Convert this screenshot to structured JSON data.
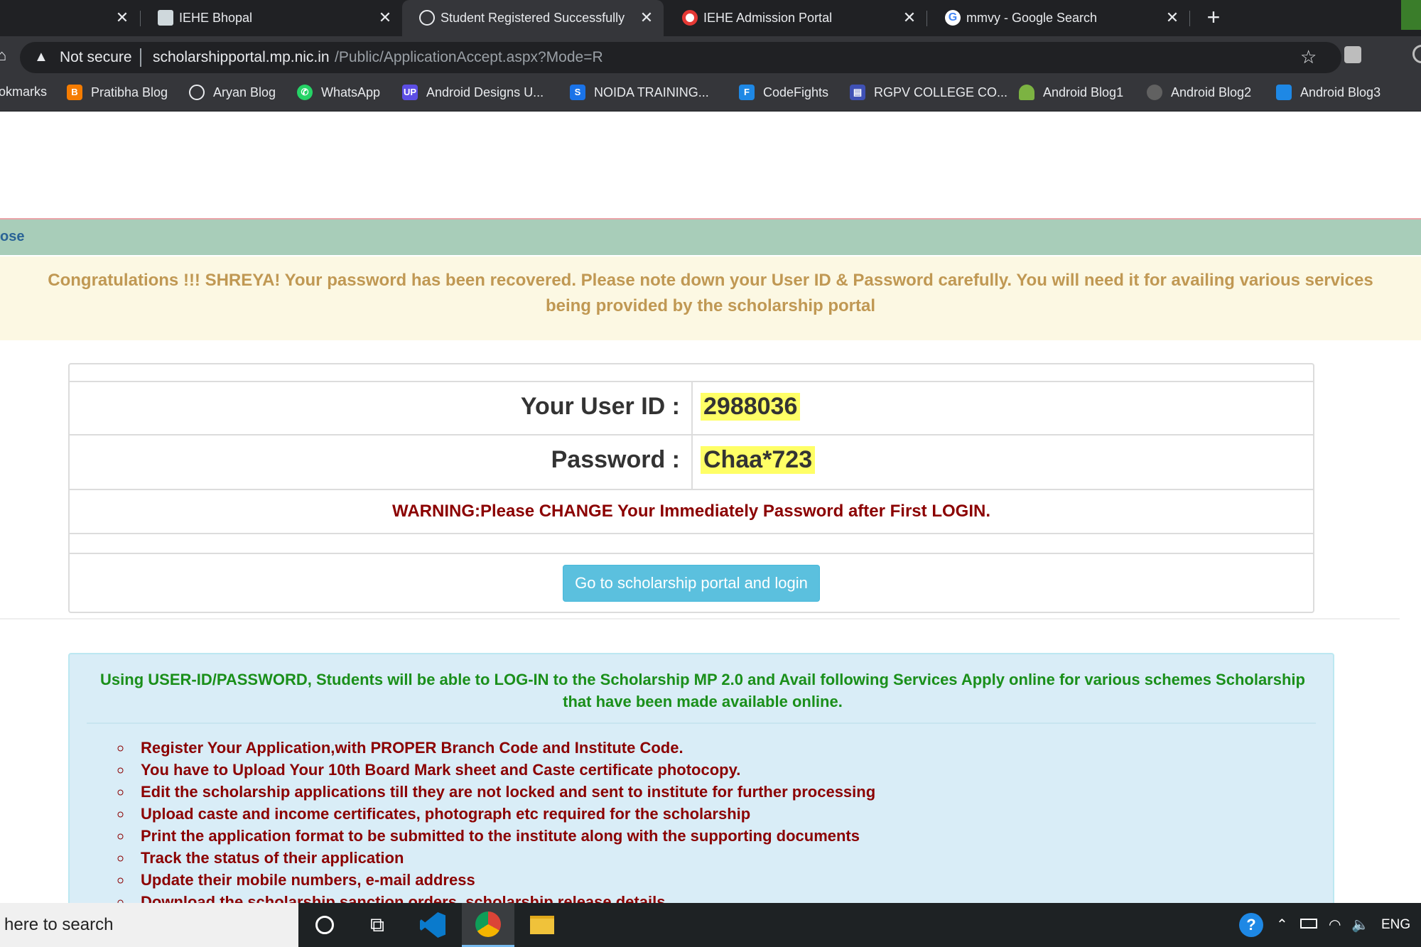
{
  "tabs": [
    {
      "title": "IEHE Bhopal",
      "active": false
    },
    {
      "title": "Student Registered Successfully",
      "active": true
    },
    {
      "title": "IEHE Admission Portal",
      "active": false
    },
    {
      "title": "mmvy - Google Search",
      "active": false
    }
  ],
  "new_tab_symbol": "+",
  "address": {
    "security": "Not secure",
    "host": "scholarshipportal.mp.nic.in",
    "path": "/Public/ApplicationAccept.aspx?Mode=R"
  },
  "bookmarks": [
    {
      "label": "okmarks",
      "icon": "folder-icon"
    },
    {
      "label": "Pratibha Blog",
      "icon": "blogger-icon",
      "color": "#f57c00"
    },
    {
      "label": "Aryan Blog",
      "icon": "globe-icon"
    },
    {
      "label": "WhatsApp",
      "icon": "whatsapp-icon",
      "color": "#25d366"
    },
    {
      "label": "Android Designs U...",
      "icon": "up-icon",
      "color": "#5c4ee5"
    },
    {
      "label": "NOIDA TRAINING...",
      "icon": "s-icon",
      "color": "#1a73e8"
    },
    {
      "label": "CodeFights",
      "icon": "codefights-icon",
      "color": "#1e88e5"
    },
    {
      "label": "RGPV COLLEGE CO...",
      "icon": "page-icon",
      "color": "#3f51b5"
    },
    {
      "label": "Android Blog1",
      "icon": "android-icon",
      "color": "#7cb342"
    },
    {
      "label": "Android Blog2",
      "icon": "avatar-icon"
    },
    {
      "label": "Android Blog3",
      "icon": "image-icon",
      "color": "#1e88e5"
    }
  ],
  "close_link": "ose",
  "congrats_message": "Congratulations !!! SHREYA! Your password has been recovered. Please note down your User ID & Password carefully. You will need it for availing various services being provided by the scholarship portal",
  "credentials": {
    "user_id_label": "Your User ID :",
    "user_id": "2988036",
    "password_label": "Password :",
    "password": "Chaa*723",
    "warning": "WARNING:Please CHANGE Your Immediately Password after First LOGIN.",
    "go_button": "Go to scholarship portal and login"
  },
  "info": {
    "heading": "Using USER-ID/PASSWORD, Students will be able to LOG-IN to the Scholarship MP 2.0 and Avail following Services Apply online for various schemes Scholarship that have been made available online.",
    "items": [
      "Register Your Application,with PROPER Branch Code and Institute Code.",
      "You have to Upload Your 10th Board Mark sheet and Caste certificate photocopy.",
      "Edit the scholarship applications till they are not locked and sent to institute for further processing",
      "Upload caste and income certificates, photograph etc required for the scholarship",
      "Print the application format to be submitted to the institute along with the supporting documents",
      "Track the status of their application",
      "Update their mobile numbers, e-mail address",
      "Download the scholarship sanction orders, scholarship release details"
    ]
  },
  "taskbar": {
    "search_placeholder": "here to search",
    "language": "ENG"
  },
  "colors": {
    "accent_green": "#a8cdb9",
    "warning_text": "#8b0000",
    "button": "#5bc0de",
    "highlight": "#ffff66"
  }
}
